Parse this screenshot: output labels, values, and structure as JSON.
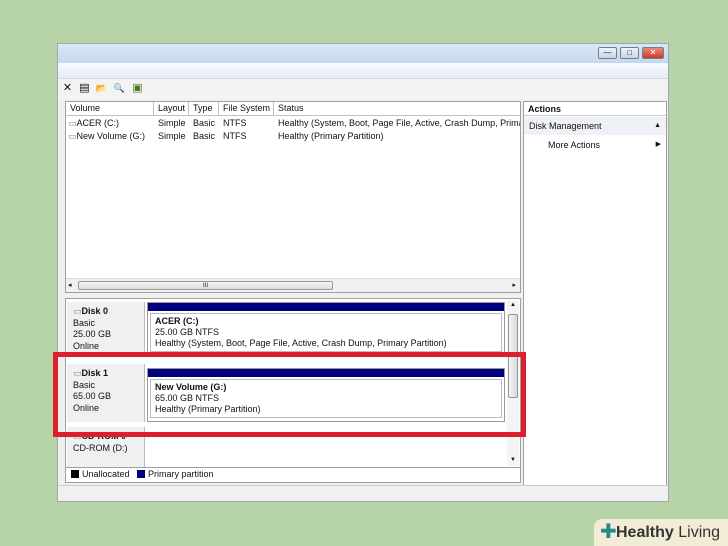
{
  "window": {
    "minimize": "—",
    "maximize": "□",
    "close": "✕"
  },
  "toolbar": [
    {
      "icon": "close-icon",
      "glyph": "✕"
    },
    {
      "icon": "properties-icon",
      "glyph": "▤"
    },
    {
      "icon": "open-folder-icon",
      "glyph": "📂"
    },
    {
      "icon": "search-icon",
      "glyph": "🔍"
    },
    {
      "icon": "help-icon",
      "glyph": "▣"
    }
  ],
  "volume_table": {
    "columns": [
      "Volume",
      "Layout",
      "Type",
      "File System",
      "Status"
    ],
    "rows": [
      [
        "ACER (C:)",
        "Simple",
        "Basic",
        "NTFS",
        "Healthy (System, Boot, Page File, Active, Crash Dump, Primary Partition)"
      ],
      [
        "New Volume (G:)",
        "Simple",
        "Basic",
        "NTFS",
        "Healthy (Primary Partition)"
      ]
    ],
    "scroll_grip": "III"
  },
  "actions": {
    "header": "Actions",
    "section": "Disk Management",
    "item": "More Actions"
  },
  "disks": [
    {
      "name": "Disk 0",
      "type": "Basic",
      "size": "25.00 GB",
      "state": "Online",
      "partition": {
        "name": "ACER  (C:)",
        "size": "25.00 GB NTFS",
        "status": "Healthy (System, Boot, Page File, Active, Crash Dump, Primary Partition)"
      }
    },
    {
      "name": "Disk 1",
      "type": "Basic",
      "size": "65.00 GB",
      "state": "Online",
      "partition": {
        "name": "New Volume  (G:)",
        "size": "65.00 GB NTFS",
        "status": "Healthy (Primary Partition)"
      }
    },
    {
      "name": "CD-ROM 0",
      "type": "CD-ROM (D:)"
    }
  ],
  "legend": [
    {
      "label": "Unallocated",
      "color": "#000000"
    },
    {
      "label": "Primary partition",
      "color": "#00007f"
    }
  ],
  "colors": {
    "primary": "#00007f",
    "highlight": "#dd1e2c",
    "background": "#b6d4a8"
  },
  "watermark": "Healthy Living"
}
